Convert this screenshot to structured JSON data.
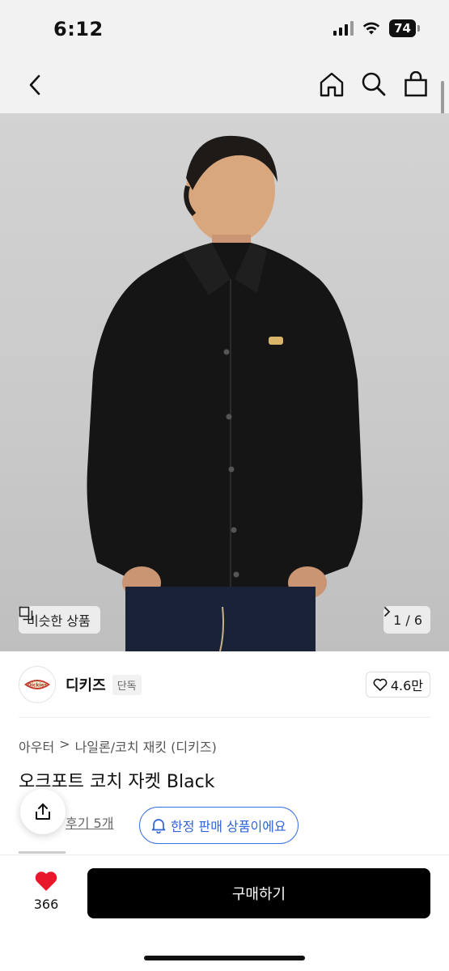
{
  "status": {
    "time": "6:12",
    "battery": "74"
  },
  "nav": {
    "back_icon": "chevron-left-icon",
    "icons": [
      "home-icon",
      "search-icon",
      "shopping-bag-icon"
    ]
  },
  "hero": {
    "similar_label": "비슷한 상품",
    "page_counter": "1 / 6"
  },
  "brand": {
    "name": "디키즈",
    "badge": "단독",
    "likes": "4.6만",
    "logo_text": "Dickies"
  },
  "breadcrumb": {
    "level1": "아우터",
    "separator": ">",
    "level2": "나일론/코치 재킷 (디키즈)"
  },
  "product": {
    "title": "오크포트 코치 자켓 Black"
  },
  "review": {
    "link": "후기 5개",
    "limited_label": "한정 판매 상품이에요"
  },
  "bottom": {
    "like_count": "366",
    "buy_label": "구매하기"
  },
  "colors": {
    "accent_blue": "#2f63d6",
    "heart_red": "#e8172b",
    "buy_button": "#000000"
  }
}
